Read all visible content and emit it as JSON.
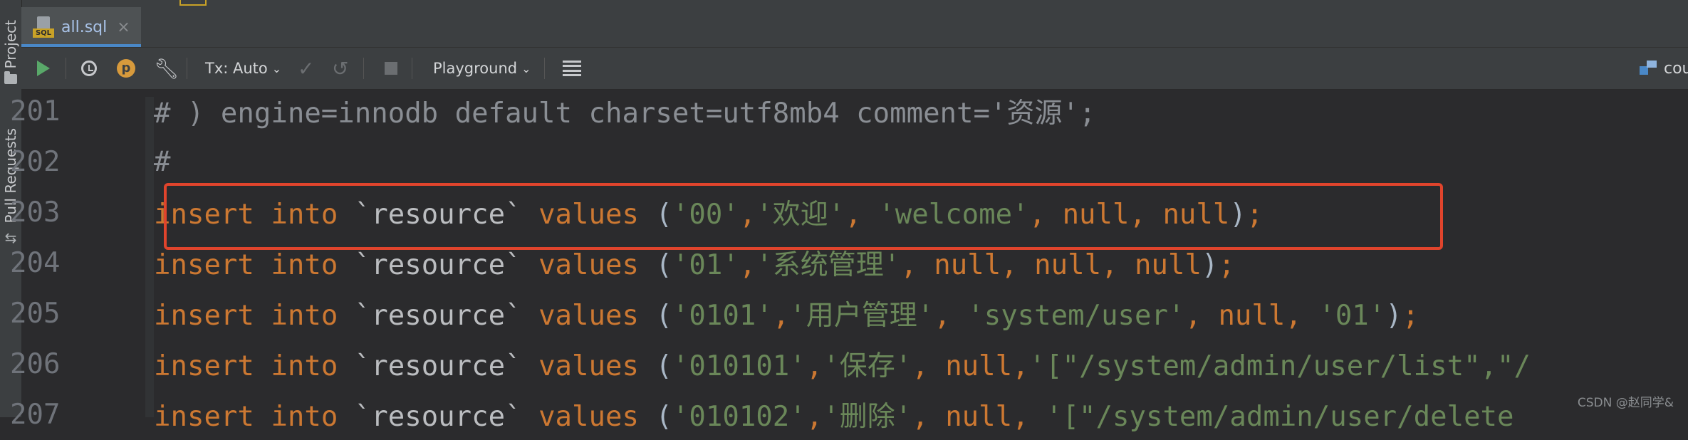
{
  "sidebar": {
    "project_label": "Project",
    "pull_requests_label": "Pull Requests"
  },
  "tab": {
    "icon_label": "SQL",
    "name": "all.sql",
    "close": "×"
  },
  "toolbar": {
    "tx_label": "Tx: Auto",
    "playground_label": "Playground",
    "right_label": "cou"
  },
  "editor": {
    "lines": [
      {
        "num": "201",
        "parts": [
          {
            "t": "# ) engine=innodb default charset=utf8mb4 comment='资源';",
            "c": "c-comment"
          }
        ]
      },
      {
        "num": "202",
        "parts": [
          {
            "t": "#",
            "c": "c-comment"
          }
        ]
      },
      {
        "num": "203",
        "parts": [
          {
            "t": "insert ",
            "c": "c-kw"
          },
          {
            "t": "into ",
            "c": "c-kw"
          },
          {
            "t": "`resource`",
            "c": "c-id"
          },
          {
            "t": " values ",
            "c": "c-kw"
          },
          {
            "t": "(",
            "c": "c-par"
          },
          {
            "t": "'00'",
            "c": "c-str"
          },
          {
            "t": ",",
            "c": "c-pun"
          },
          {
            "t": "'欢迎'",
            "c": "c-str"
          },
          {
            "t": ", ",
            "c": "c-pun"
          },
          {
            "t": "'welcome'",
            "c": "c-str"
          },
          {
            "t": ", ",
            "c": "c-pun"
          },
          {
            "t": "null",
            "c": "c-kw"
          },
          {
            "t": ", ",
            "c": "c-pun"
          },
          {
            "t": "null",
            "c": "c-kw"
          },
          {
            "t": ")",
            "c": "c-par"
          },
          {
            "t": ";",
            "c": "c-pun"
          }
        ]
      },
      {
        "num": "204",
        "parts": [
          {
            "t": "insert ",
            "c": "c-kw"
          },
          {
            "t": "into ",
            "c": "c-kw"
          },
          {
            "t": "`resource`",
            "c": "c-id"
          },
          {
            "t": " values ",
            "c": "c-kw"
          },
          {
            "t": "(",
            "c": "c-par"
          },
          {
            "t": "'01'",
            "c": "c-str"
          },
          {
            "t": ",",
            "c": "c-pun"
          },
          {
            "t": "'系统管理'",
            "c": "c-str"
          },
          {
            "t": ", ",
            "c": "c-pun"
          },
          {
            "t": "null",
            "c": "c-kw"
          },
          {
            "t": ", ",
            "c": "c-pun"
          },
          {
            "t": "null",
            "c": "c-kw"
          },
          {
            "t": ", ",
            "c": "c-pun"
          },
          {
            "t": "null",
            "c": "c-kw"
          },
          {
            "t": ")",
            "c": "c-par"
          },
          {
            "t": ";",
            "c": "c-pun"
          }
        ]
      },
      {
        "num": "205",
        "parts": [
          {
            "t": "insert ",
            "c": "c-kw"
          },
          {
            "t": "into ",
            "c": "c-kw"
          },
          {
            "t": "`resource`",
            "c": "c-id"
          },
          {
            "t": " values ",
            "c": "c-kw"
          },
          {
            "t": "(",
            "c": "c-par"
          },
          {
            "t": "'0101'",
            "c": "c-str"
          },
          {
            "t": ",",
            "c": "c-pun"
          },
          {
            "t": "'用户管理'",
            "c": "c-str"
          },
          {
            "t": ", ",
            "c": "c-pun"
          },
          {
            "t": "'system/user'",
            "c": "c-str"
          },
          {
            "t": ", ",
            "c": "c-pun"
          },
          {
            "t": "null",
            "c": "c-kw"
          },
          {
            "t": ", ",
            "c": "c-pun"
          },
          {
            "t": "'01'",
            "c": "c-str"
          },
          {
            "t": ")",
            "c": "c-par"
          },
          {
            "t": ";",
            "c": "c-pun"
          }
        ]
      },
      {
        "num": "206",
        "parts": [
          {
            "t": "insert ",
            "c": "c-kw"
          },
          {
            "t": "into ",
            "c": "c-kw"
          },
          {
            "t": "`resource`",
            "c": "c-id"
          },
          {
            "t": " values ",
            "c": "c-kw"
          },
          {
            "t": "(",
            "c": "c-par"
          },
          {
            "t": "'010101'",
            "c": "c-str"
          },
          {
            "t": ",",
            "c": "c-pun"
          },
          {
            "t": "'保存'",
            "c": "c-str"
          },
          {
            "t": ", ",
            "c": "c-pun"
          },
          {
            "t": "null",
            "c": "c-kw"
          },
          {
            "t": ",",
            "c": "c-pun"
          },
          {
            "t": "'[\"/system/admin/user/list\",\"/",
            "c": "c-str"
          }
        ]
      },
      {
        "num": "207",
        "parts": [
          {
            "t": "insert ",
            "c": "c-kw"
          },
          {
            "t": "into ",
            "c": "c-kw"
          },
          {
            "t": "`resource`",
            "c": "c-id"
          },
          {
            "t": " values ",
            "c": "c-kw"
          },
          {
            "t": "(",
            "c": "c-par"
          },
          {
            "t": "'010102'",
            "c": "c-str"
          },
          {
            "t": ",",
            "c": "c-pun"
          },
          {
            "t": "'删除'",
            "c": "c-str"
          },
          {
            "t": ", ",
            "c": "c-pun"
          },
          {
            "t": "null",
            "c": "c-kw"
          },
          {
            "t": ", ",
            "c": "c-pun"
          },
          {
            "t": "'[\"/system/admin/user/delete",
            "c": "c-str"
          }
        ]
      }
    ]
  },
  "watermark": "CSDN @赵同学&",
  "colors": {
    "highlight_border": "#e0442c",
    "keyword": "#cc7832",
    "string": "#6a8759",
    "comment": "#8a8e94"
  }
}
